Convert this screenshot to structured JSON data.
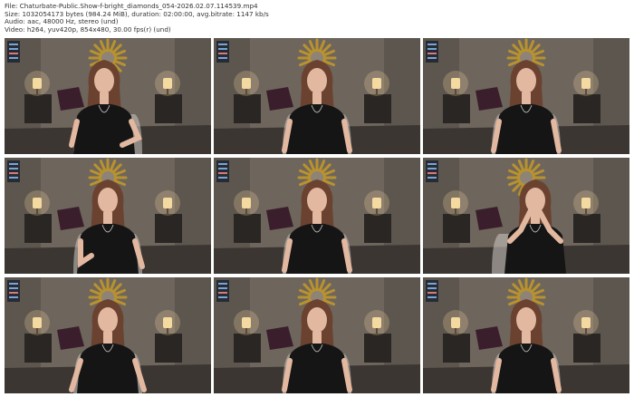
{
  "header": {
    "file_line": "File: Chaturbate-Public.Show-f-bright_diamonds_054-2026.02.07.114539.mp4",
    "size_line": "Size: 1032054173 bytes (984.24 MiB), duration: 02:00:00, avg.bitrate: 1147 kb/s",
    "audio_line": "Audio: aac, 48000 Hz, stereo (und)",
    "video_line": "Video: h264, yuv420p, 854x480, 30.00 fps(r) (und)"
  },
  "thumbnails": [
    {
      "pose": "hair-touch"
    },
    {
      "pose": "look-down"
    },
    {
      "pose": "smile"
    },
    {
      "pose": "hand-up"
    },
    {
      "pose": "centered"
    },
    {
      "pose": "hands-face"
    },
    {
      "pose": "lean"
    },
    {
      "pose": "arms-down"
    },
    {
      "pose": "smile"
    }
  ],
  "colors": {
    "wall": "#6e655c",
    "floor": "#3b3632",
    "mirror_gold": "#b8922f",
    "lamp_glow": "#f4d9a0",
    "top_black": "#151515",
    "hair": "#6b4230",
    "skin": "#e3b8a0"
  }
}
